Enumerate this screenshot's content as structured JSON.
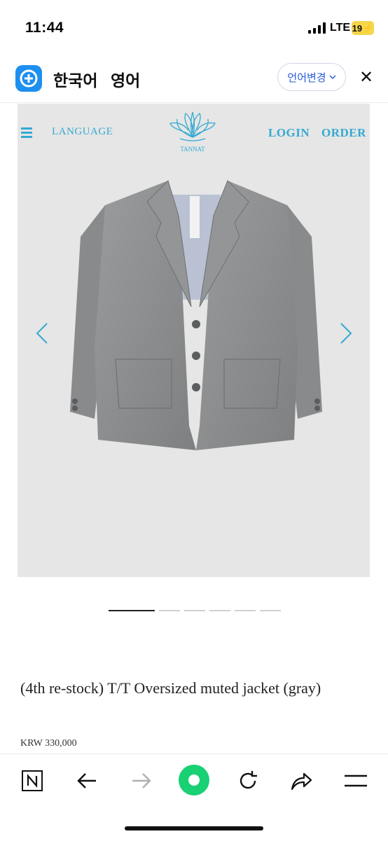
{
  "status": {
    "time": "11:44",
    "network": "LTE",
    "battery": "19"
  },
  "translate_bar": {
    "tabs": [
      {
        "label": "한국어"
      },
      {
        "label": "영어"
      }
    ],
    "change_label": "언어변경",
    "close_icon": "close-icon",
    "colors": {
      "accent": "#1d8ff0",
      "change_text": "#2a5bd8"
    }
  },
  "site_header": {
    "language_label": "LANGUAGE",
    "login_label": "LOGIN",
    "order_label": "ORDER",
    "logo_text": "TANNAT",
    "accent_color": "#35a9d4"
  },
  "carousel": {
    "total": 6,
    "current": 1
  },
  "product": {
    "title": "(4th re-stock) T/T Oversized muted jacket (gray)",
    "price": "KRW 330,000"
  },
  "browser_nav": {
    "items": [
      "naver-n-icon",
      "back-icon",
      "forward-icon",
      "home-dot-icon",
      "refresh-icon",
      "share-icon",
      "menu-icon"
    ],
    "accent": "#19d074"
  }
}
